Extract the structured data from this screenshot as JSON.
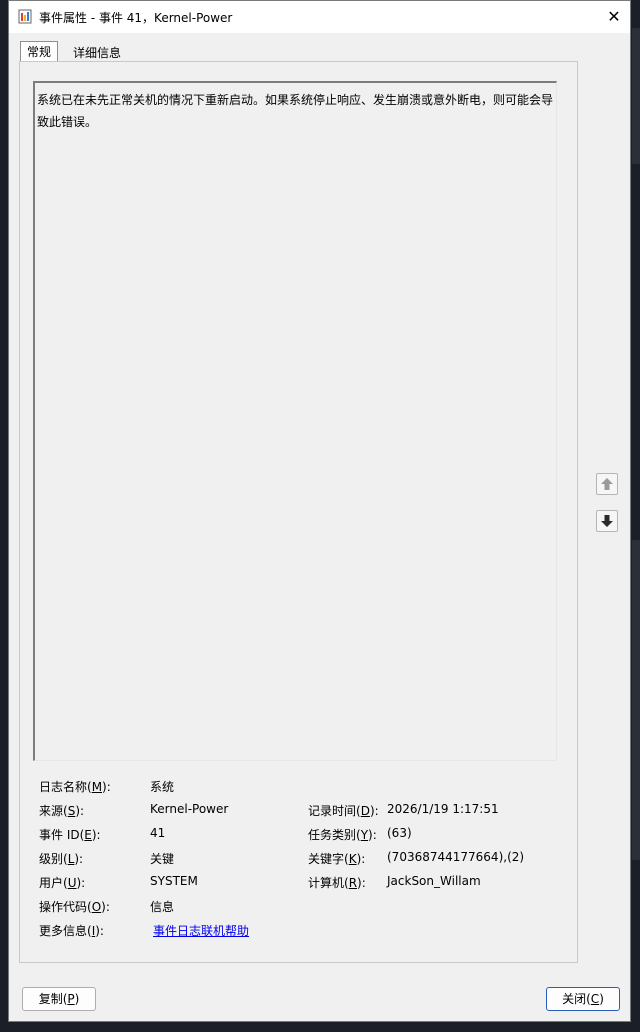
{
  "window": {
    "title": "事件属性 - 事件 41，Kernel-Power"
  },
  "tabs": [
    {
      "label": "常规",
      "active": true
    },
    {
      "label": "详细信息",
      "active": false
    }
  ],
  "description": "系统已在未先正常关机的情况下重新启动。如果系统停止响应、发生崩溃或意外断电，则可能会导致此错误。",
  "fields": {
    "log_name": {
      "label_pre": "日志名称(",
      "key": "M",
      "label_post": "):",
      "value": "系统"
    },
    "source": {
      "label_pre": "来源(",
      "key": "S",
      "label_post": "):",
      "value": "Kernel-Power"
    },
    "logged": {
      "label_pre": "记录时间(",
      "key": "D",
      "label_post": "):",
      "value": "2026/1/19 1:17:51"
    },
    "event_id": {
      "label_pre": "事件 ID(",
      "key": "E",
      "label_post": "):",
      "value": "41"
    },
    "task_category": {
      "label_pre": "任务类别(",
      "key": "Y",
      "label_post": "):",
      "value": "(63)"
    },
    "level": {
      "label_pre": "级别(",
      "key": "L",
      "label_post": "):",
      "value": "关键"
    },
    "keywords": {
      "label_pre": "关键字(",
      "key": "K",
      "label_post": "):",
      "value": "(70368744177664),(2)"
    },
    "user": {
      "label_pre": "用户(",
      "key": "U",
      "label_post": "):",
      "value": "SYSTEM"
    },
    "computer": {
      "label_pre": "计算机(",
      "key": "R",
      "label_post": "):",
      "value": "JackSon_Willam"
    },
    "opcode": {
      "label_pre": "操作代码(",
      "key": "O",
      "label_post": "):",
      "value": "信息"
    },
    "more_info": {
      "label_pre": "更多信息(",
      "key": "I",
      "label_post": "):",
      "value": "事件日志联机帮助"
    }
  },
  "buttons": {
    "copy": {
      "label_pre": "复制(",
      "key": "P",
      "label_post": ")"
    },
    "close": {
      "label_pre": "关闭(",
      "key": "C",
      "label_post": ")"
    }
  },
  "icons": {
    "close": "close-icon",
    "up": "arrow-up-icon",
    "down": "arrow-down-icon"
  }
}
